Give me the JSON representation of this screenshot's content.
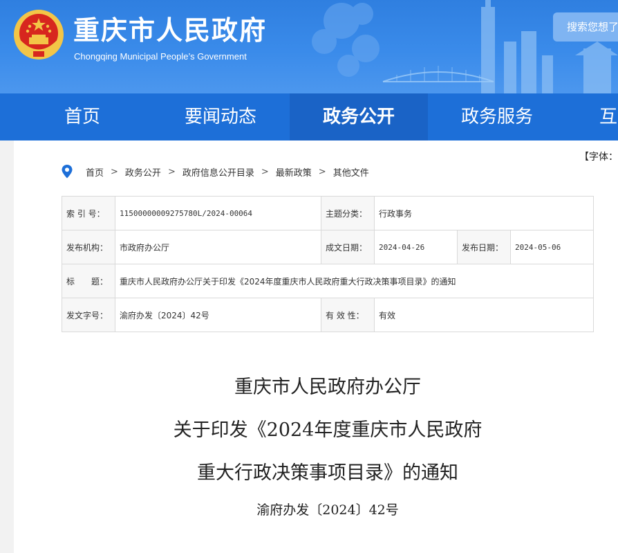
{
  "site": {
    "title": "重庆市人民政府",
    "subtitle": "Chongqing Municipal People’s Government",
    "search_placeholder": "搜索您想了"
  },
  "nav": {
    "items": [
      {
        "label": "首页"
      },
      {
        "label": "要闻动态"
      },
      {
        "label": "政务公开"
      },
      {
        "label": "政务服务"
      },
      {
        "label": "互"
      }
    ],
    "active_index": 2
  },
  "font_size_control": "【字体：",
  "breadcrumb": [
    "首页",
    "政务公开",
    "政府信息公开目录",
    "最新政策",
    "其他文件"
  ],
  "breadcrumb_sep": ">",
  "info": {
    "index_label": "索 引 号：",
    "index_value": "11500000009275780L/2024-00064",
    "topic_label": "主题分类：",
    "topic_value": "行政事务",
    "issuer_label": "发布机构：",
    "issuer_value": "市政府办公厅",
    "written_label": "成文日期：",
    "written_value": "2024-04-26",
    "published_label": "发布日期：",
    "published_value": "2024-05-06",
    "title_label": "标　　题：",
    "title_value": "重庆市人民政府办公厅关于印发《2024年度重庆市人民政府重大行政决策事项目录》的通知",
    "docno_label": "发文字号：",
    "docno_value": "渝府办发〔2024〕42号",
    "validity_label": "有 效 性：",
    "validity_value": "有效"
  },
  "document": {
    "title_line1": "重庆市人民政府办公厅",
    "title_line2": "关于印发《2024年度重庆市人民政府",
    "title_line3": "重大行政决策事项目录》的通知",
    "number": "渝府办发〔2024〕42号"
  },
  "colors": {
    "banner": "#3a8bea",
    "nav": "#1d6fd8",
    "nav_active": "#1a63c6",
    "emblem_red": "#d7261e",
    "emblem_gold": "#f3c547"
  }
}
